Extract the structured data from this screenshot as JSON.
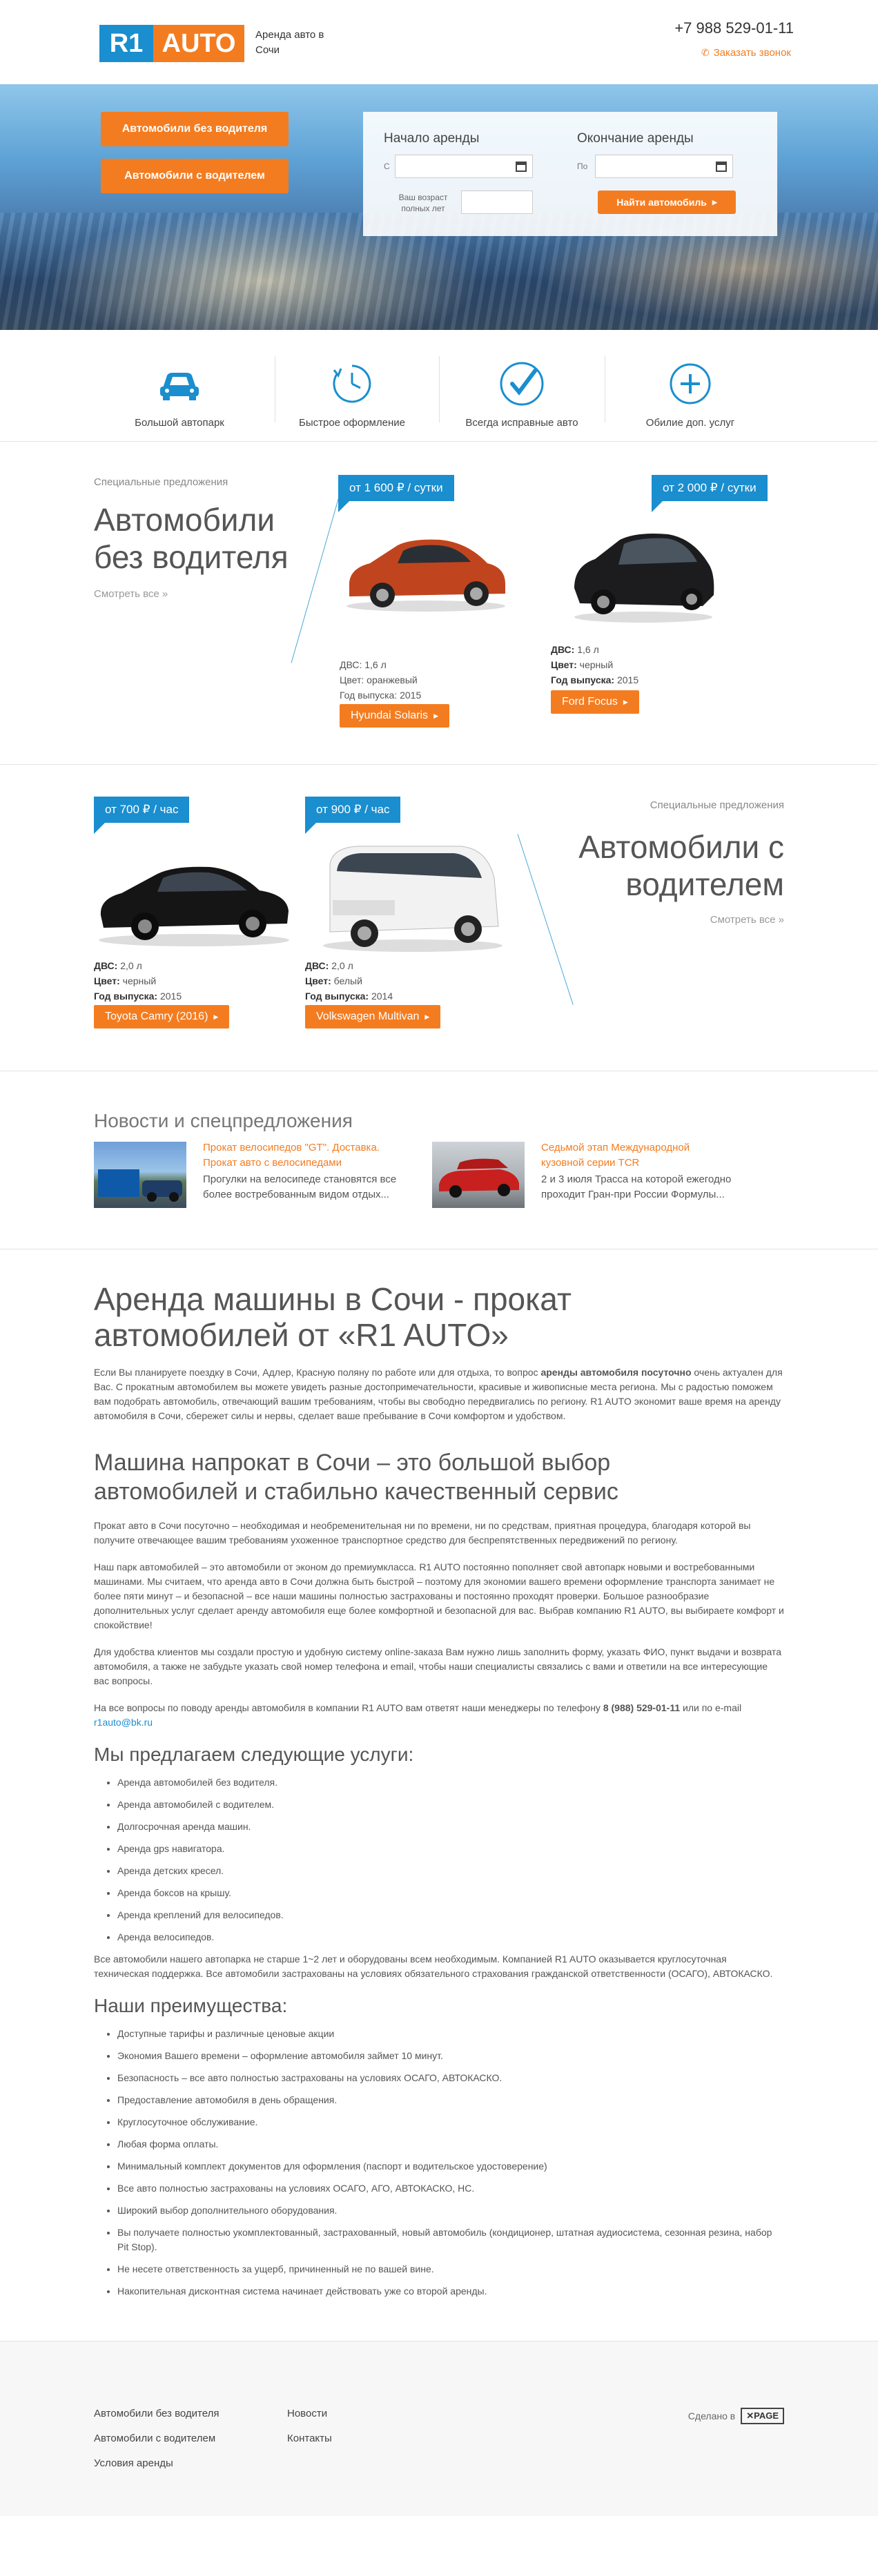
{
  "header": {
    "logo_left": "R1",
    "logo_right": "AUTO",
    "tagline": "Аренда авто в Сочи",
    "phone": "+7 988 529-01-11",
    "callback_label": "Заказать звонок"
  },
  "hero": {
    "btn_no_driver": "Автомобили без водителя",
    "btn_with_driver": "Автомобили с водителем",
    "start_label": "Начало аренды",
    "end_label": "Окончание аренды",
    "from_prefix": "С",
    "to_prefix": "По",
    "age_label": "Ваш возраст полных лет",
    "find_label": "Найти автомобиль"
  },
  "features": [
    {
      "label": "Большой автопарк",
      "icon": "car-icon"
    },
    {
      "label": "Быстрое оформление",
      "icon": "clock-icon"
    },
    {
      "label": "Всегда исправные авто",
      "icon": "checkmark-icon"
    },
    {
      "label": "Обилие доп. услуг",
      "icon": "plus-icon"
    }
  ],
  "offer1": {
    "small": "Специальные предложения",
    "title": "Автомобили без водителя",
    "more": "Смотреть все »",
    "cars": [
      {
        "price": "от 1 600 ₽ / сутки",
        "engine_label": "ДВС:",
        "engine": "1,6 л",
        "color_label": "Цвет:",
        "color": "оранжевый",
        "year_label": "Год выпуска:",
        "year": "2015",
        "button": "Hyundai Solaris",
        "car_color": "#c0451e"
      },
      {
        "price": "от 2 000 ₽ / сутки",
        "engine_label": "ДВС:",
        "engine": "1,6 л",
        "color_label": "Цвет:",
        "color": "черный",
        "year_label": "Год выпуска:",
        "year": "2015",
        "button": "Ford Focus",
        "car_color": "#1c1c1e"
      }
    ]
  },
  "offer2": {
    "small": "Специальные предложения",
    "title": "Автомобили с водителем",
    "more": "Смотреть все »",
    "cars": [
      {
        "price": "от 700 ₽ / час",
        "engine_label": "ДВС:",
        "engine": "2,0 л",
        "color_label": "Цвет:",
        "color": "черный",
        "year_label": "Год выпуска:",
        "year": "2015",
        "button": "Toyota Camry (2016)",
        "car_color": "#151515"
      },
      {
        "price": "от 900 ₽ / час",
        "engine_label": "ДВС:",
        "engine": "2,0 л",
        "color_label": "Цвет:",
        "color": "белый",
        "year_label": "Год выпуска:",
        "year": "2014",
        "button": "Volkswagen Multivan",
        "car_color": "#f2f2f2"
      }
    ]
  },
  "news": {
    "heading": "Новости и спецпредложения",
    "items": [
      {
        "title": "Прокат велосипедов \"GT\". Доставка. Прокат авто с велосипедами",
        "text": "Прогулки на велосипеде становятся все более востребованным видом отдых..."
      },
      {
        "title": "Седьмой этап Международной кузовной серии TCR",
        "text": "2 и 3 июля Трасса на которой ежегодно проходит Гран-при России Формулы..."
      }
    ]
  },
  "article": {
    "h1": "Аренда машины в Сочи - прокат автомобилей от «R1 AUTO»",
    "p1_a": "Если Вы планируете поездку в Сочи, Адлер, Красную поляну по работе или для отдыха, то вопрос ",
    "p1_b": "аренды автомобиля посуточно",
    "p1_c": " очень актуален для Вас. С прокатным автомобилем вы можете увидеть разные достопримечательности, красивые и живописные места региона. Мы с радостью поможем вам подобрать автомобиль, отвечающий вашим требованиям, чтобы вы свободно передвигались по региону. R1 AUTO экономит ваше время на аренду автомобиля в Сочи, сбережет силы и нервы, сделает ваше пребывание в Сочи комфортом и удобством.",
    "h2": "Машина напрокат в Сочи – это большой выбор автомобилей и стабильно качественный сервис",
    "p2": "Прокат авто в Сочи посуточно – необходимая и необременительная ни по времени, ни по средствам, приятная процедура, благодаря которой вы получите отвечающее вашим требованиям ухоженное транспортное средство для беспрепятственных передвижений по региону.",
    "p3": "Наш парк автомобилей – это автомобили от эконом до премиумкласса. R1 AUTO постоянно пополняет свой автопарк новыми и востребованными машинами. Мы считаем, что аренда авто в Сочи должна быть быстрой – поэтому для экономии вашего времени оформление транспорта занимает не более пяти минут – и безопасной – все наши машины полностью застрахованы и постоянно проходят проверки. Большое разнообразие дополнительных услуг сделает аренду автомобиля еще более комфортной и безопасной для вас. Выбрав компанию R1 AUTO, вы выбираете комфорт и спокойствие!",
    "p4": "Для удобства клиентов мы создали простую и удобную систему online-заказа Вам нужно лишь заполнить форму, указать ФИО, пункт выдачи и возврата автомобиля, а также не забудьте указать свой номер телефона и email, чтобы наши специалисты связались с вами и ответили на все интересующие вас вопросы.",
    "p5_a": "На все вопросы по поводу аренды автомобиля в компании R1 AUTO вам ответят наши менеджеры по телефону ",
    "p5_b": "8 (988) 529-01-11",
    "p5_c": " или по e-mail ",
    "p5_email": "r1auto@bk.ru",
    "h3_services": "Мы предлагаем следующие услуги:",
    "services": [
      "Аренда автомобилей без водителя.",
      "Аренда автомобилей с водителем.",
      "Долгосрочная аренда машин.",
      "Аренда gps навигатора.",
      "Аренда детских кресел.",
      "Аренда боксов на крышу.",
      "Аренда креплений для велосипедов.",
      "Аренда велосипедов."
    ],
    "p6": "Все автомобили нашего автопарка не старше 1~2 лет и оборудованы всем необходимым. Компанией R1 AUTO оказывается круглосуточная техническая поддержка. Все автомобили застрахованы на условиях обязательного страхования гражданской ответственности (ОСАГО), АВТОКАСКО.",
    "h3_adv": "Наши преимущества:",
    "advantages": [
      "Доступные тарифы и различные ценовые акции",
      "Экономия Вашего времени – оформление автомобиля займет 10 минут.",
      "Безопасность – все авто полностью застрахованы на условиях ОСАГО, АВТОКАСКО.",
      "Предоставление автомобиля в день обращения.",
      "Круглосуточное обслуживание.",
      "Любая форма оплаты.",
      "Минимальный комплект документов для оформления (паспорт и водительское удостоверение)",
      "Все авто полностью застрахованы на условиях ОСАГО, АГО, АВТОКАСКО, НС.",
      "Широкий выбор дополнительного оборудования.",
      "Вы получаете полностью укомплектованный, застрахованный, новый автомобиль (кондиционер, штатная аудиосистема, сезонная резина, набор Pit Stop).",
      "Не несете ответственность за ущерб, причиненный не по вашей вине.",
      "Накопительная дисконтная система начинает действовать уже со второй аренды."
    ]
  },
  "footer": {
    "col1": [
      "Автомобили без водителя",
      "Автомобили с водителем",
      "Условия аренды"
    ],
    "col2": [
      "Новости",
      "Контакты"
    ],
    "made_by": "Сделано в",
    "made_brand": "PAGE"
  }
}
